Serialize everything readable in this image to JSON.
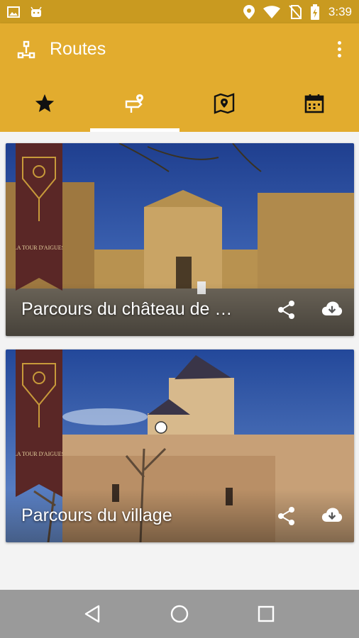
{
  "status_bar": {
    "time": "3:39",
    "left_icons": [
      "image-icon",
      "android-icon"
    ],
    "right_icons": [
      "location-pin-icon",
      "wifi-icon",
      "no-sim-icon",
      "battery-charging-icon"
    ]
  },
  "app_bar": {
    "title": "Routes",
    "logo_icon": "routes-logo-icon",
    "overflow_icon": "more-vert-icon",
    "background_color": "#e2ac2e"
  },
  "tabs": [
    {
      "icon": "star-icon",
      "active": false
    },
    {
      "icon": "route-sign-icon",
      "active": true
    },
    {
      "icon": "map-pin-icon",
      "active": false
    },
    {
      "icon": "calendar-icon",
      "active": false
    }
  ],
  "routes": [
    {
      "title": "Parcours du château de La Tour d'Aigues",
      "banner_text": "LA TOUR D'AIGUES",
      "share_icon": "share-icon",
      "download_icon": "cloud-download-icon"
    },
    {
      "title": "Parcours du village",
      "banner_text": "LA TOUR D'AIGUES",
      "share_icon": "share-icon",
      "download_icon": "cloud-download-icon"
    }
  ],
  "nav_bar": {
    "icons": [
      "back-icon",
      "home-icon",
      "recents-icon"
    ]
  }
}
